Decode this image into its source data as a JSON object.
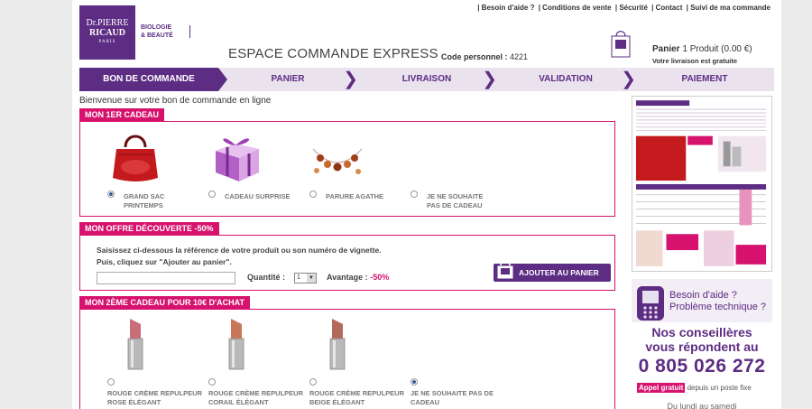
{
  "header": {
    "links": [
      "| Besoin d'aide ?",
      "| Conditions de vente",
      "| Sécurité",
      "| Contact",
      "| Suivi de ma commande"
    ],
    "logo": {
      "line1": "Dr.PIERRE",
      "line2": "RICAUD",
      "line3": "PARIS"
    },
    "tagline": {
      "line1": "BIOLOGIE",
      "line2": "& BEAUTÉ"
    },
    "title": "ESPACE COMMANDE EXPRESS",
    "code_label": "Code personnel :",
    "code_value": "4221",
    "cart_label": "Panier",
    "cart_count": "1 Produit (0.00 €)",
    "cart_shipping": "Votre livraison est gratuite"
  },
  "steps": [
    "BON DE COMMANDE",
    "PANIER",
    "LIVRAISON",
    "VALIDATION",
    "PAIEMENT"
  ],
  "active_step": 0,
  "welcome": "Bienvenue sur votre bon de commande en ligne",
  "gift1": {
    "title": "MON 1ER CADEAU",
    "options": [
      {
        "label1": "GRAND SAC",
        "label2": "PRINTEMPS",
        "selected": true,
        "icon": "red-bag-image"
      },
      {
        "label1": "CADEAU SURPRISE",
        "label2": "",
        "selected": false,
        "icon": "gift-box-image"
      },
      {
        "label1": "PARURE AGATHE",
        "label2": "",
        "selected": false,
        "icon": "necklace-image"
      },
      {
        "label1": "JE NE SOUHAITE",
        "label2": "PAS DE CADEAU",
        "selected": false,
        "icon": ""
      }
    ]
  },
  "offer": {
    "title": "MON OFFRE DÉCOUVERTE -50%",
    "line1": "Saisissez ci-dessous la référence de votre produit ou son numéro de vignette.",
    "line2": "Puis, cliquez sur \"Ajouter au panier\".",
    "input_value": "",
    "qty_label": "Quantité :",
    "qty_value": "1",
    "adv_label": "Avantage :",
    "adv_value": "-50%",
    "add_button": "AJOUTER AU PANIER"
  },
  "gift2": {
    "title": "MON 2ÈME CADEAU POUR 10€ D'ACHAT",
    "options": [
      {
        "label1": "ROUGE CRÈME REPULPEUR",
        "label2": "ROSE ÉLÉGANT",
        "selected": false
      },
      {
        "label1": "ROUGE CRÈME REPULPEUR",
        "label2": "CORAIL ÉLÉGANT",
        "selected": false
      },
      {
        "label1": "ROUGE CRÈME REPULPEUR",
        "label2": "BEIGE ÉLÉGANT",
        "selected": false
      },
      {
        "label1": "JE NE SOUHAITE PAS DE",
        "label2": "CADEAU",
        "selected": true
      }
    ]
  },
  "help": {
    "q1": "Besoin d'aide ?",
    "q2": "Problème technique ?",
    "line1": "Nos conseillères",
    "line2": "vous répondent au",
    "number": "0 805 026 272",
    "free_badge": "Appel gratuit",
    "free_text": "depuis un poste fixe",
    "hours": "Du lundi au samedi"
  },
  "colors": {
    "brand": "#5d2c83",
    "accent": "#d6126e"
  }
}
